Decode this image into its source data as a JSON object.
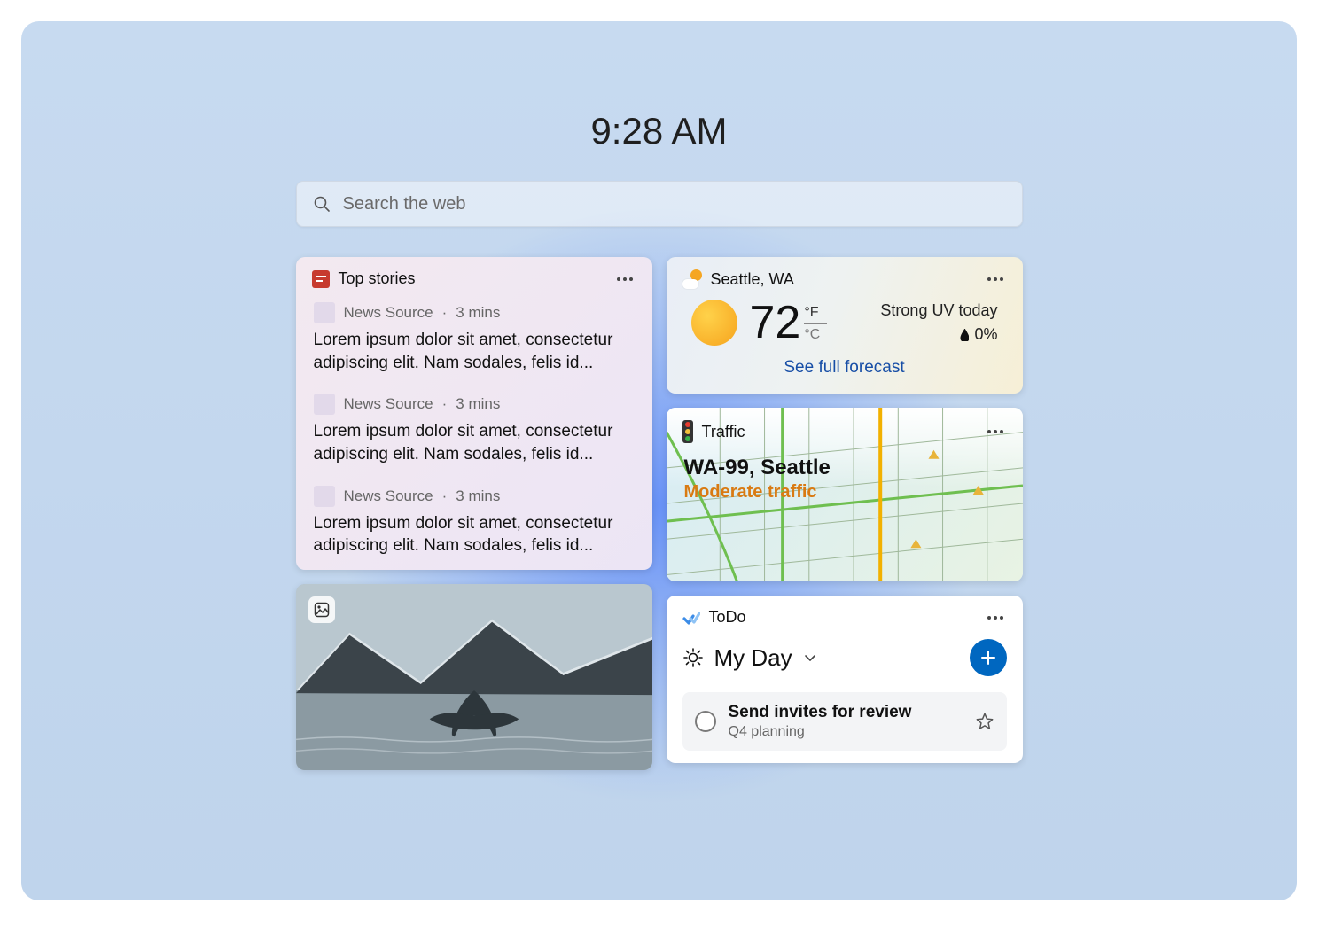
{
  "clock": "9:28 AM",
  "search": {
    "placeholder": "Search the web"
  },
  "topStories": {
    "title": "Top stories",
    "items": [
      {
        "source": "News Source",
        "age": "3 mins",
        "headline": "Lorem ipsum dolor sit amet, consectetur adipiscing elit. Nam sodales, felis id..."
      },
      {
        "source": "News Source",
        "age": "3 mins",
        "headline": "Lorem ipsum dolor sit amet, consectetur adipiscing elit. Nam sodales, felis id..."
      },
      {
        "source": "News Source",
        "age": "3 mins",
        "headline": "Lorem ipsum dolor sit amet, consectetur adipiscing elit. Nam sodales, felis id..."
      }
    ]
  },
  "weather": {
    "location": "Seattle, WA",
    "temp": "72",
    "unitF": "°F",
    "unitC": "°C",
    "alert": "Strong UV today",
    "precip": "0%",
    "link": "See full forecast"
  },
  "traffic": {
    "title": "Traffic",
    "route": "WA-99, Seattle",
    "status": "Moderate traffic"
  },
  "todo": {
    "title": "ToDo",
    "list": "My Day",
    "tasks": [
      {
        "title": "Send invites for review",
        "sub": "Q4 planning"
      }
    ]
  }
}
